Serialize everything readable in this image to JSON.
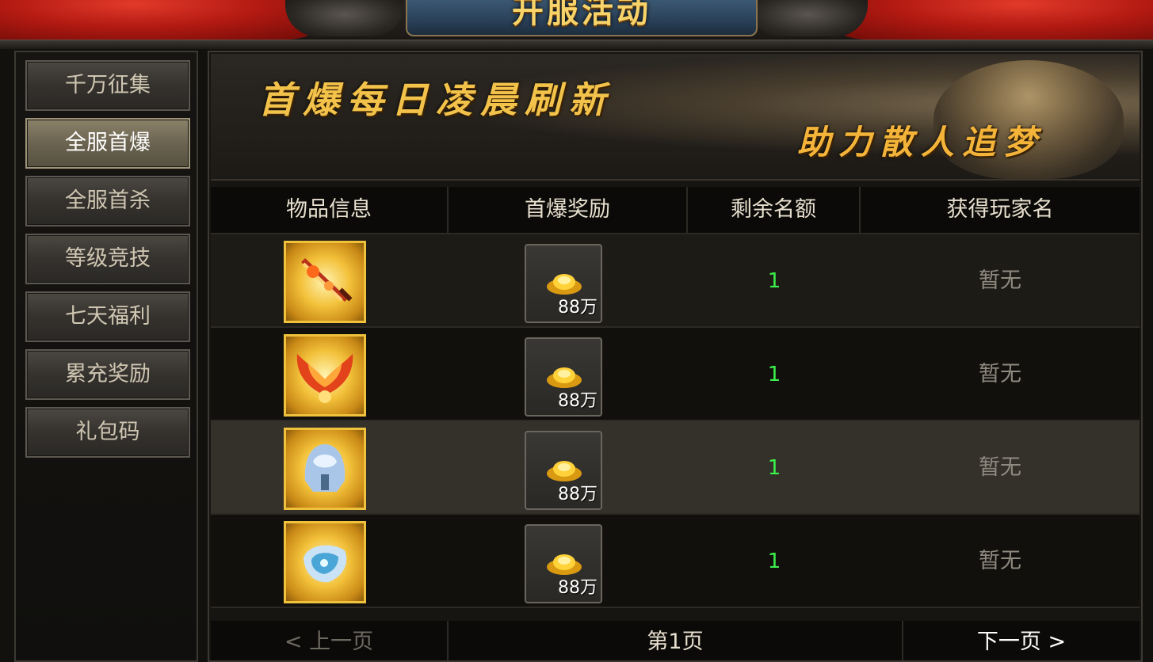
{
  "window": {
    "title": "开服活动"
  },
  "sidebar": {
    "items": [
      {
        "label": "千万征集",
        "active": false
      },
      {
        "label": "全服首爆",
        "active": true
      },
      {
        "label": "全服首杀",
        "active": false
      },
      {
        "label": "等级竞技",
        "active": false
      },
      {
        "label": "七天福利",
        "active": false
      },
      {
        "label": "累充奖励",
        "active": false
      },
      {
        "label": "礼包码",
        "active": false
      }
    ]
  },
  "banner": {
    "headline": "首爆每日凌晨刷新",
    "tagline": "助力散人追梦"
  },
  "table": {
    "headers": [
      "物品信息",
      "首爆奖励",
      "剩余名额",
      "获得玩家名"
    ],
    "rows": [
      {
        "item_icon": "flame-sword-icon",
        "reward_icon": "gold-ingot-icon",
        "reward_amount": "88万",
        "remaining": "1",
        "player": "暂无"
      },
      {
        "item_icon": "fire-wings-icon",
        "reward_icon": "gold-ingot-icon",
        "reward_amount": "88万",
        "remaining": "1",
        "player": "暂无"
      },
      {
        "item_icon": "ice-helmet-icon",
        "reward_icon": "gold-ingot-icon",
        "reward_amount": "88万",
        "remaining": "1",
        "player": "暂无"
      },
      {
        "item_icon": "ice-bracer-icon",
        "reward_icon": "gold-ingot-icon",
        "reward_amount": "88万",
        "remaining": "1",
        "player": "暂无"
      }
    ]
  },
  "pagination": {
    "prev": "< 上一页",
    "current": "第1页",
    "next": "下一页 >"
  },
  "colors": {
    "remaining_green": "#3cf04a",
    "banner_gold": "#f2c24a",
    "item_frame_gold": "#f0c23c"
  }
}
